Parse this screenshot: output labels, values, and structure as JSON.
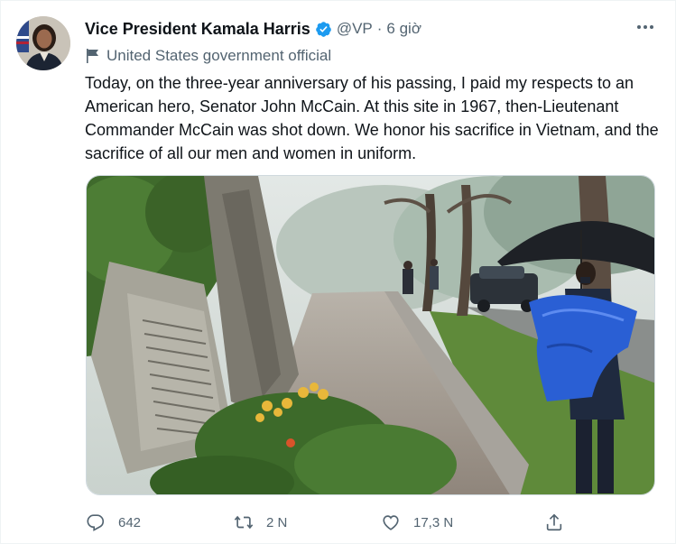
{
  "tweet": {
    "author_name": "Vice President Kamala Harris",
    "handle": "@VP",
    "separator": "·",
    "time_ago": "6 giờ",
    "label": "United States government official",
    "text": "Today, on the three-year anniversary of his passing, I paid my respects to an American hero, Senator John McCain. At this site in 1967, then-Lieutenant Commander McCain was shot down. We honor his sacrifice in Vietnam, and the sacrifice of all our men and women in uniform.",
    "accent_color": "#1d9bf0"
  },
  "actions": {
    "reply_count": "642",
    "retweet_count": "2 N",
    "like_count": "17,3 N"
  },
  "icons": [
    "verified-badge-icon",
    "flag-icon",
    "more-icon",
    "reply-icon",
    "retweet-icon",
    "like-icon",
    "share-icon"
  ]
}
